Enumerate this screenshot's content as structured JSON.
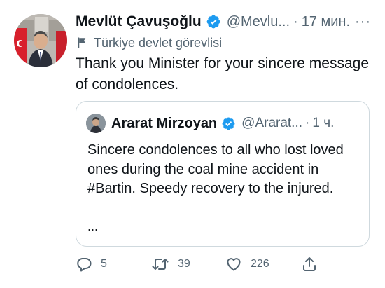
{
  "tweet": {
    "author_name": "Mevlüt Çavuşoğlu",
    "handle": "@Mevlu...",
    "separator": "·",
    "time": "17 мин.",
    "more_label": "···",
    "affiliation_label": "Türkiye devlet görevlisi",
    "text": "Thank you Minister for your sincere message of condolences."
  },
  "quoted_tweet": {
    "author_name": "Ararat Mirzoyan",
    "handle": "@Ararat...",
    "separator": "·",
    "time": "1 ч.",
    "text_before_hashtag": "Sincere condolences to all who lost loved ones during the coal mine accident in ",
    "hashtag": "#Bartin",
    "text_after_hashtag": ". Speedy recovery to the injured.",
    "ellipsis": "..."
  },
  "actions": {
    "replies": "5",
    "retweets": "39",
    "likes": "226"
  },
  "colors": {
    "verified_badge": "#1d9bf0",
    "secondary_text": "#536471",
    "border": "#cfd9de"
  },
  "icons": {
    "verified": "verified-badge-icon",
    "affiliation": "flag-icon",
    "reply": "reply-icon",
    "retweet": "retweet-icon",
    "like": "heart-icon",
    "share": "share-icon"
  }
}
